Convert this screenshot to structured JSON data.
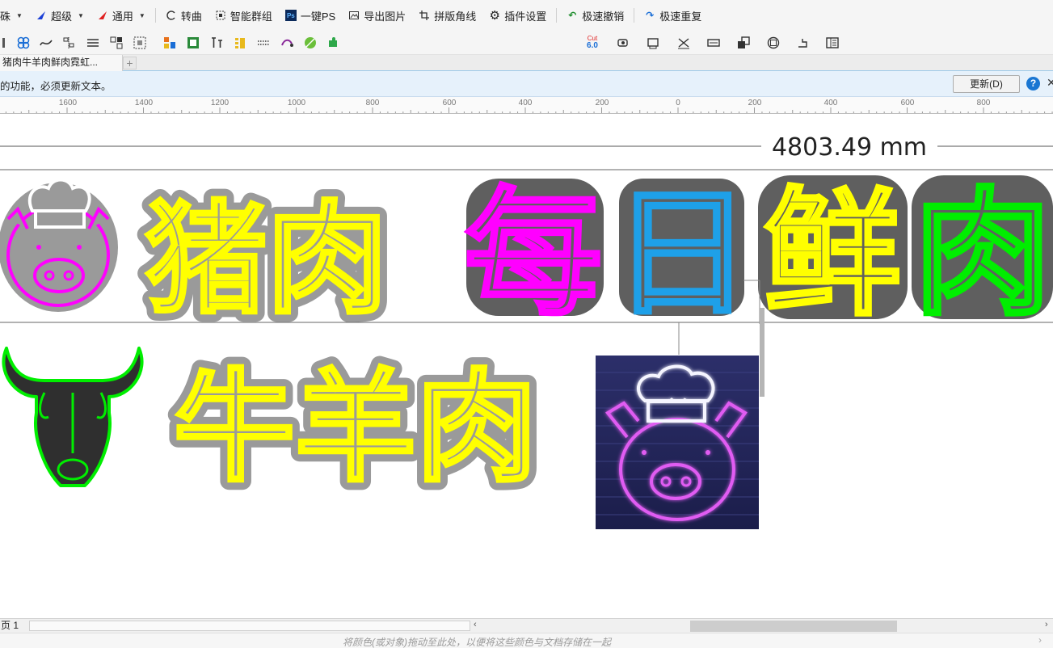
{
  "toolbar_main": {
    "items": [
      {
        "label": "硃",
        "icon": "brush-icon"
      },
      {
        "label": "超级",
        "icon": "super-tool-icon"
      },
      {
        "label": "通用",
        "icon": "general-tool-icon"
      },
      {
        "label": "转曲",
        "icon": "convert-curve-icon"
      },
      {
        "label": "智能群组",
        "icon": "smart-group-icon"
      },
      {
        "label": "一键PS",
        "icon": "ps-icon"
      },
      {
        "label": "导出图片",
        "icon": "export-image-icon"
      },
      {
        "label": "拼版角线",
        "icon": "crop-marks-icon"
      },
      {
        "label": "插件设置",
        "icon": "gear-icon"
      },
      {
        "label": "极速撤销",
        "icon": "undo-icon"
      },
      {
        "label": "极速重复",
        "icon": "redo-icon"
      }
    ]
  },
  "toolbar_secondary": {
    "cut_badge_top": "Cut",
    "cut_badge_bottom": "6.0"
  },
  "document_tab": {
    "label": "猪肉牛羊肉鲜肉霓虹...",
    "add": "+"
  },
  "infobar": {
    "message": "的功能，必须更新文本。",
    "update_button": "更新(D)",
    "help": "?",
    "close": "✕"
  },
  "ruler": {
    "labels": [
      "1600",
      "1400",
      "1200",
      "1000",
      "800",
      "600",
      "400",
      "200",
      "0",
      "200",
      "400",
      "600",
      "800"
    ]
  },
  "canvas": {
    "dimension_label": "4803.49 mm",
    "top_row_text_1": "猪肉",
    "top_row_text_2": [
      "每",
      "日",
      "鲜",
      "肉"
    ],
    "bottom_row_text": "牛羊肉",
    "colors": {
      "neon_magenta": "#ff00ff",
      "neon_yellow": "#ffff00",
      "neon_blue": "#1ea0e8",
      "neon_green": "#00ee00",
      "dark_gray_bg": "#5f5f5f",
      "light_gray_bg": "#9a9a9a"
    }
  },
  "pagebar": {
    "page_label": "页 1",
    "scroll_left": "‹",
    "scroll_right": "›"
  },
  "statusbar": {
    "hint": "将颜色(或对象)拖动至此处，以便将这些颜色与文档存储在一起",
    "chevron": "›"
  }
}
